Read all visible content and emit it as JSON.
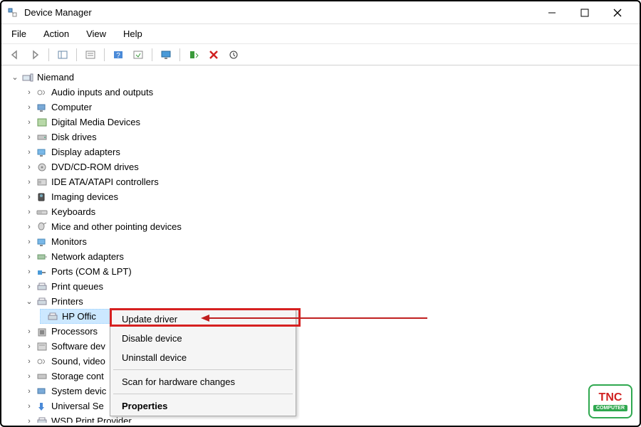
{
  "window": {
    "title": "Device Manager"
  },
  "menubar": {
    "file": "File",
    "action": "Action",
    "view": "View",
    "help": "Help"
  },
  "tree": {
    "root": "Niemand",
    "categories": [
      "Audio inputs and outputs",
      "Computer",
      "Digital Media Devices",
      "Disk drives",
      "Display adapters",
      "DVD/CD-ROM drives",
      "IDE ATA/ATAPI controllers",
      "Imaging devices",
      "Keyboards",
      "Mice and other pointing devices",
      "Monitors",
      "Network adapters",
      "Ports (COM & LPT)",
      "Print queues"
    ],
    "printers": {
      "label": "Printers",
      "selected_device": "HP Offic"
    },
    "after": [
      "Processors",
      "Software dev",
      "Sound, video",
      "Storage cont",
      "System devic",
      "Universal Se",
      "WSD Print Provider"
    ]
  },
  "context_menu": {
    "update_driver": "Update driver",
    "disable_device": "Disable device",
    "uninstall_device": "Uninstall device",
    "scan_changes": "Scan for hardware changes",
    "properties": "Properties"
  },
  "logo": {
    "brand": "TNC",
    "sub": "COMPUTER"
  }
}
